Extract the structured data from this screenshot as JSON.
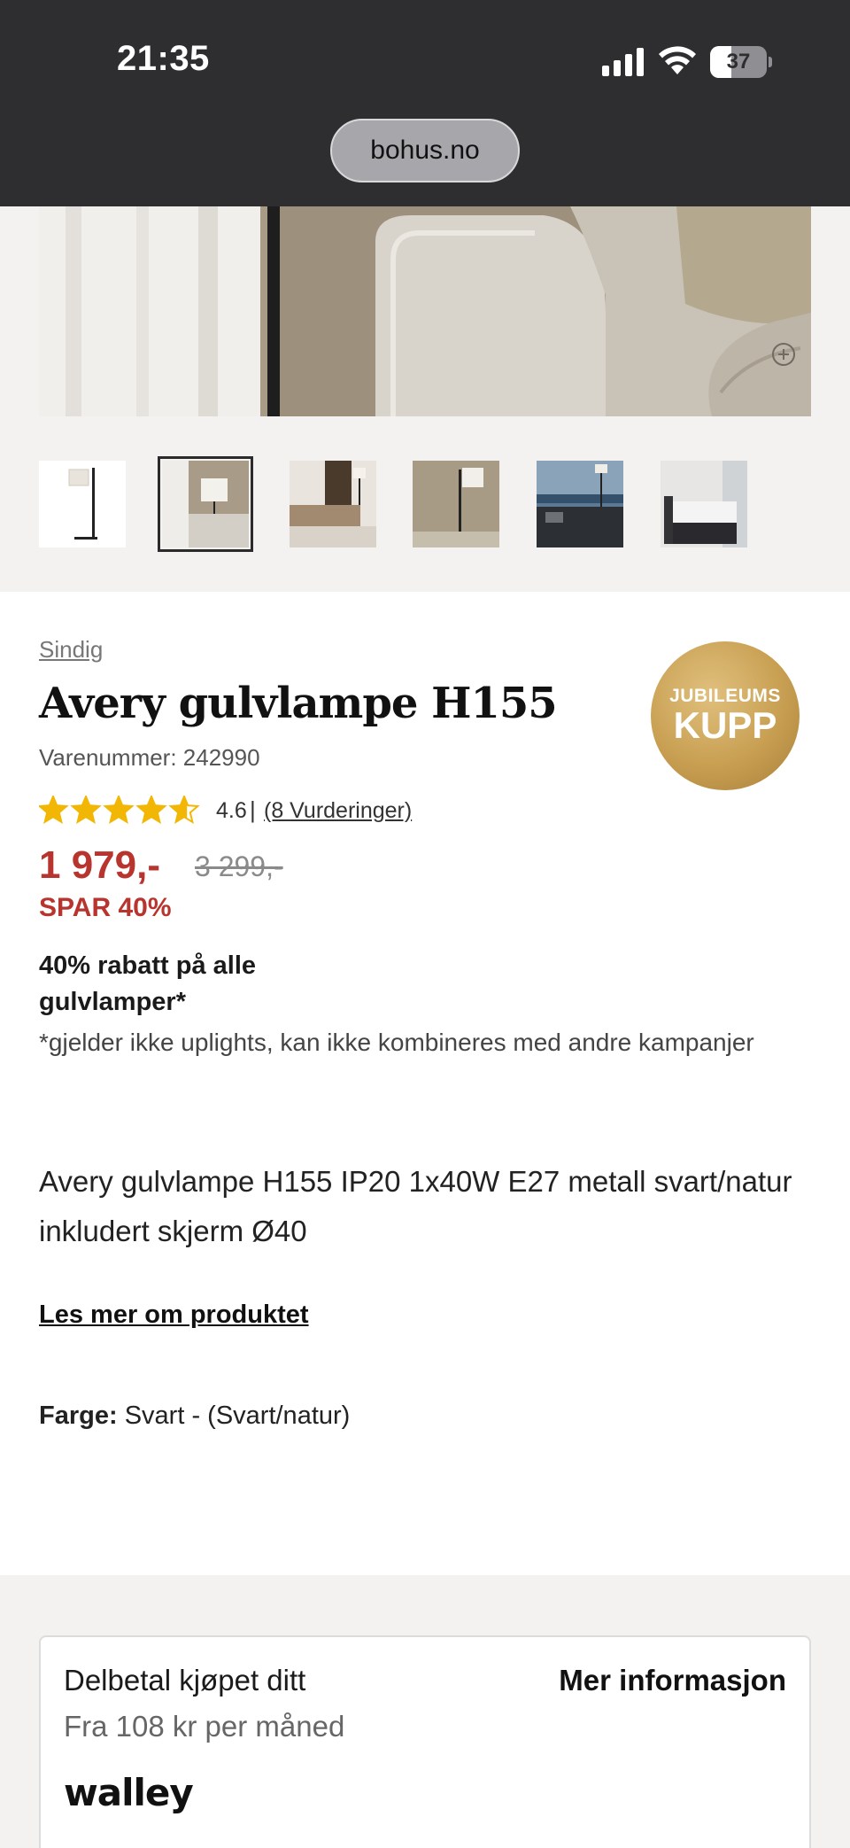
{
  "status_bar": {
    "time": "21:35",
    "battery": "37",
    "battery_level": 0.37,
    "url": "bohus.no"
  },
  "gallery": {
    "thumbnails": [
      {
        "name": "thumb-lamp-white"
      },
      {
        "name": "thumb-lamp-sofa",
        "selected": true
      },
      {
        "name": "thumb-living-room"
      },
      {
        "name": "thumb-lamp-wall"
      },
      {
        "name": "thumb-sofa-window"
      },
      {
        "name": "thumb-bedroom"
      }
    ],
    "zoom_icon": "zoom-in-icon"
  },
  "product": {
    "brand": "Sindig",
    "title": "Avery gulvlampe H155",
    "sku": "Varenummer: 242990",
    "badge_line1": "JUBILEUMS",
    "badge_line2": "KUPP",
    "rating": {
      "stars": 4.6,
      "value": "4.6",
      "separator": "|",
      "reviews_link": "(8 Vurderinger)"
    },
    "price": "1 979,-",
    "old_price": "3 299,-",
    "save": "SPAR 40%",
    "promo_title": "40% rabatt på alle gulvlamper*",
    "promo_note": "*gjelder ikke uplights, kan ikke kombineres med andre kampanjer",
    "description": "Avery gulvlampe H155 IP20 1x40W E27 metall svart/natur inkludert skjerm Ø40",
    "read_more": "Les mer om produktet",
    "color_label": "Farge:",
    "color_value": "Svart - (Svart/natur)"
  },
  "payment": {
    "title": "Delbetal kjøpet ditt",
    "subtitle": "Fra 108 kr per måned",
    "more_info": "Mer informasjon",
    "provider": "walley"
  },
  "colors": {
    "status_bg": "#2e2e31",
    "price_red": "#b8342f",
    "star_gold": "#f2b705",
    "badge_gold": "#c89f52",
    "section_bg": "#f3f2f0"
  }
}
